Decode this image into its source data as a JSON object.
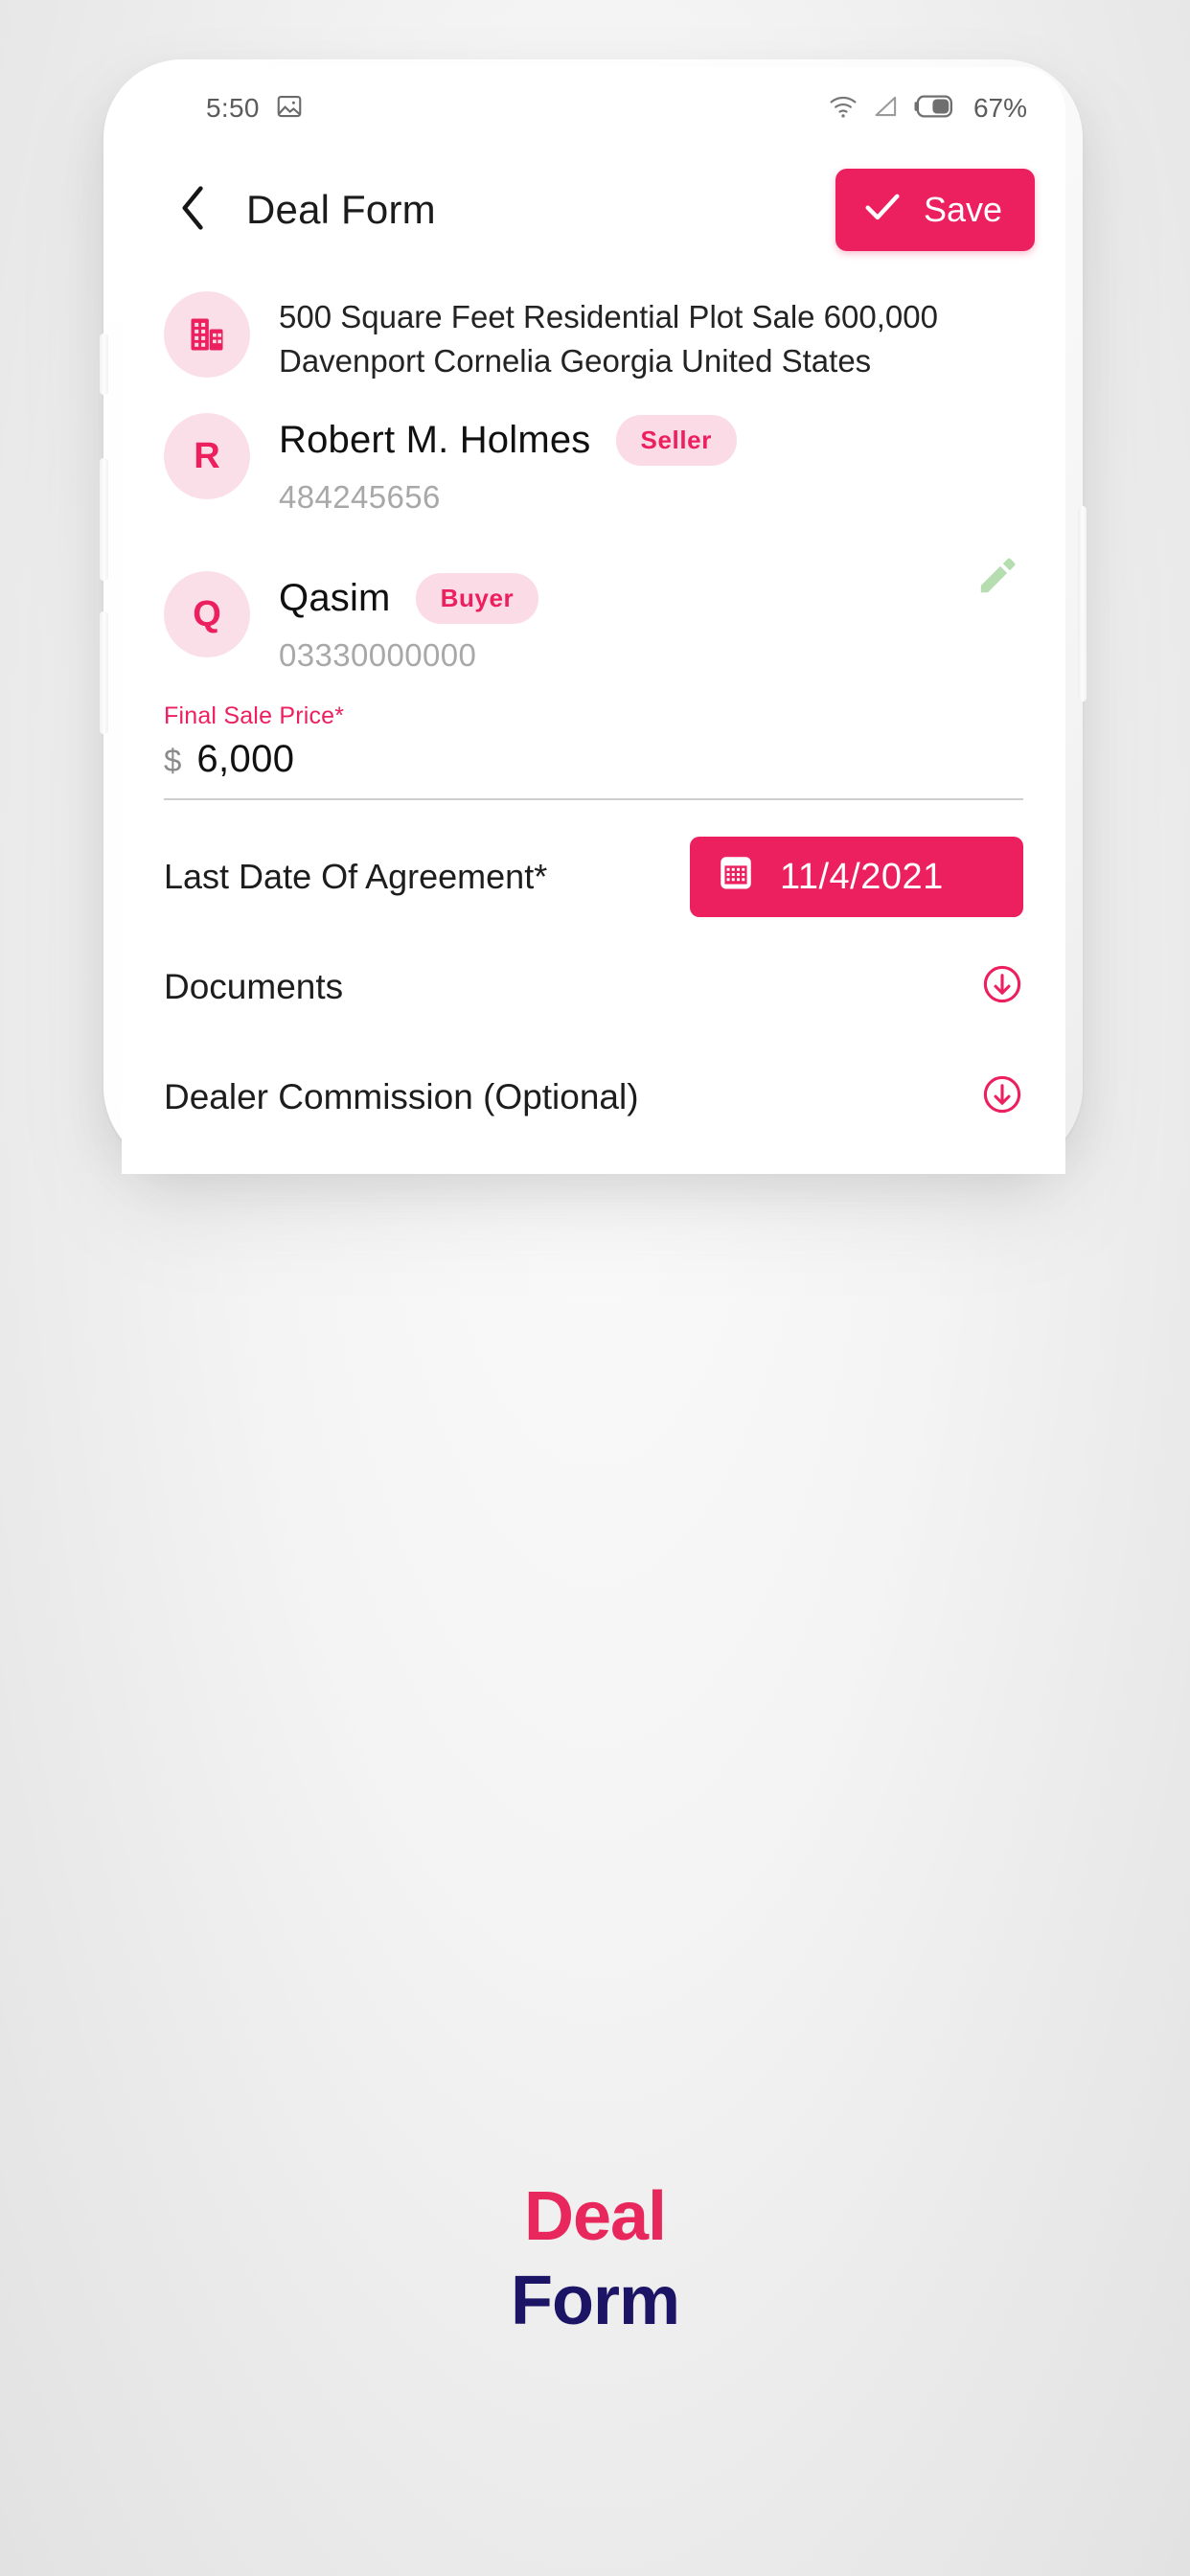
{
  "theme": {
    "accent": "#ec1f5f",
    "accent_soft": "#fbdce6",
    "caption_pink": "#e8275c",
    "caption_navy": "#1c1464",
    "edit_green": "#b5ddb0",
    "muted_text": "#a8a8a8"
  },
  "status_bar": {
    "time": "5:50",
    "gallery_icon": "image-icon",
    "wifi_icon": "wifi-icon",
    "signal_icon": "signal-triangle-icon",
    "battery_icon": "battery-icon",
    "battery_text": "67%"
  },
  "header": {
    "back_icon": "chevron-left-icon",
    "title": "Deal Form",
    "save_label": "Save",
    "save_icon": "check-icon"
  },
  "property": {
    "icon": "building-icon",
    "description": "500 Square Feet Residential Plot Sale 600,000 Davenport Cornelia Georgia United States"
  },
  "parties": [
    {
      "initial": "R",
      "name": "Robert M. Holmes",
      "role": "Seller",
      "phone": "484245656",
      "editable": false
    },
    {
      "initial": "Q",
      "name": "Qasim",
      "role": "Buyer",
      "phone": "03330000000",
      "editable": true,
      "edit_icon": "pencil-icon"
    }
  ],
  "price_field": {
    "label": "Final Sale Price*",
    "currency": "$",
    "value": "6,000"
  },
  "date_field": {
    "label": "Last Date Of Agreement*",
    "calendar_icon": "calendar-icon",
    "value": "11/4/2021"
  },
  "sections": [
    {
      "label": "Documents",
      "toggle_icon": "circle-arrow-down-icon"
    },
    {
      "label": "Dealer Commission (Optional)",
      "toggle_icon": "circle-arrow-down-icon"
    }
  ],
  "caption": {
    "line1": "Deal",
    "line2": "Form"
  }
}
